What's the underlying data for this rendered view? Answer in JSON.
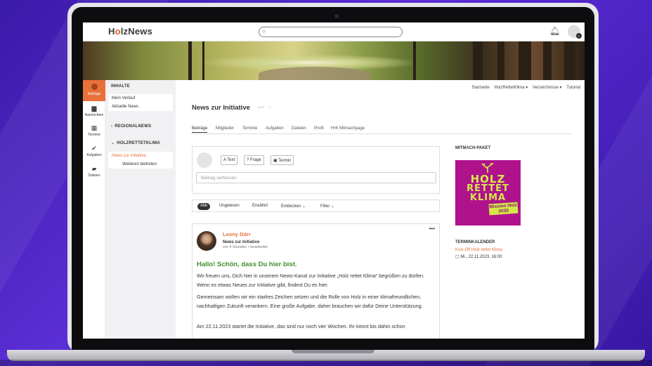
{
  "colors": {
    "accent": "#e8703a",
    "headline": "#3f8f2a",
    "package_bg": "#b0128c",
    "package_fg": "#d4e84a"
  },
  "header": {
    "logo_prefix": "H",
    "logo_o": "o",
    "logo_suffix": "lzNews",
    "search_icon": "search-icon",
    "bell_icon": "bell-icon",
    "avatar_icon": "avatar-icon"
  },
  "leftnav": [
    {
      "label": "Beiträge",
      "icon": "posts-icon"
    },
    {
      "label": "Nachrichten",
      "icon": "inbox-icon"
    },
    {
      "label": "Termine",
      "icon": "calendar-icon"
    },
    {
      "label": "Aufgaben",
      "icon": "check-icon"
    },
    {
      "label": "Dateien",
      "icon": "folder-icon"
    }
  ],
  "sidebar": {
    "title": "INHALTE",
    "links": [
      "Mein Verlauf",
      "Aktuelle News"
    ],
    "section1": "REGIONALNEWS",
    "section2": "HOLZRETTETKLIMA",
    "sub_active": "News zur Initiative",
    "sub_join": "Weiteren beitreten"
  },
  "topnav": [
    "Startseite",
    "HolzRettetKlima ▾",
    "Verzeichnisse ▾",
    "Tutorial"
  ],
  "main": {
    "title": "News zur Initiative",
    "title_more": "···",
    "title_star": "☆",
    "tabs": [
      "Beiträge",
      "Mitglieder",
      "Termine",
      "Aufgaben",
      "Dateien",
      "Profil",
      "HrK Mitmachpage"
    ]
  },
  "composer": {
    "btn_text": "A Text",
    "btn_question": "? Frage",
    "btn_event": "▣ Termin",
    "placeholder": "Beitrag verfassen"
  },
  "filters": [
    "Alle",
    "Ungelesen",
    "Erwähnt",
    "Entdecken ⌄",
    "Filter ⌄"
  ],
  "post": {
    "author": "Leony Dörr",
    "space": "News zur Initiative",
    "meta": "vor 4 Stunden • bearbeitet",
    "more": "•••",
    "headline": "Hallo! Schön, dass Du hier bist.",
    "p1": "Wir freuen uns, Dich hier in unserem News-Kanal zur Initiative „Holz rettet Klima“ begrüßen zu dürfen. Wenn es etwas Neues zur Initiative gibt, findest Du es hier.",
    "p2": "Gemeinsam wollen wir ein starkes Zeichen setzen und die Rolle von Holz in einer klimafreundlichen, nachhaltigen Zukunft verankern. Eine große Aufgabe, daher brauchen wir dafür Deine Unterstützung.",
    "p3": "Am 22.11.2023 startet die Initiative, das sind nur noch vier Wochen. Ihr könnt bis dahin schon"
  },
  "right": {
    "package_title": "MITMACH-PAKET",
    "package_line1": "HOLZ",
    "package_line2": "RETTET",
    "package_line3": "KLIMA",
    "package_tag1": "Mission Holz",
    "package_tag2": "2030",
    "calendar_title": "TERMINKALENDER",
    "event_name": "Kick-Off Holz rettet Klima",
    "event_date": "▢ Mi., 22.11.2023, 16:00"
  }
}
